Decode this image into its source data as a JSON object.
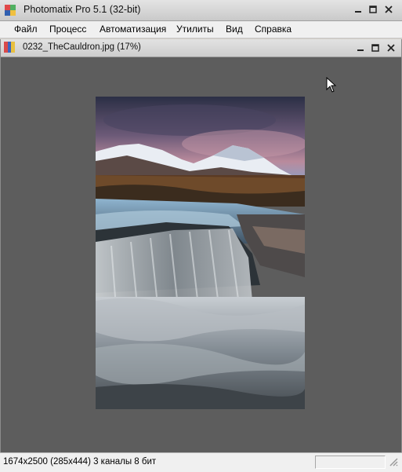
{
  "window": {
    "title": "Photomatix Pro 5.1 (32-bit)",
    "controls": [
      "minimize-icon",
      "maximize-icon",
      "close-icon"
    ]
  },
  "menu": {
    "items": [
      "Файл",
      "Процесс",
      "Автоматизация",
      "Утилиты",
      "Вид",
      "Справка"
    ]
  },
  "document": {
    "title": "0232_TheCauldron.jpg (17%)",
    "image_icon": "mountain-waterfall-photo"
  },
  "status": {
    "info": "1674x2500 (285x444) 3 каналы 8 бит"
  },
  "colors": {
    "workspace": "#5d5d5d",
    "chrome": "#f0f0f0"
  }
}
